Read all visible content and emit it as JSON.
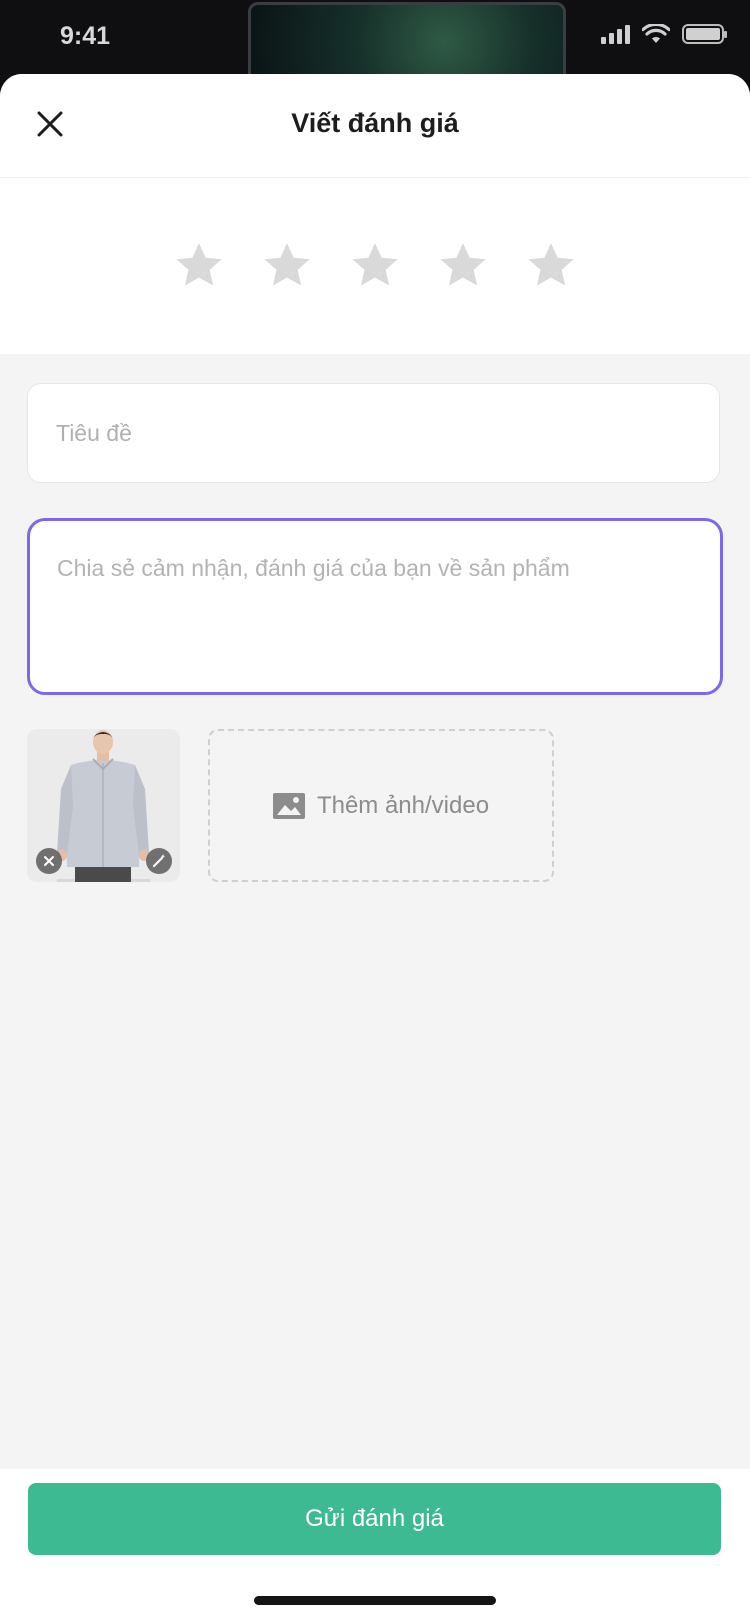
{
  "status_bar": {
    "time": "9:41",
    "icons": [
      "signal-icon",
      "wifi-icon",
      "battery-icon"
    ]
  },
  "header": {
    "title": "Viết đánh giá",
    "close_icon": "close-icon"
  },
  "rating": {
    "max_stars": 5,
    "selected": 0,
    "star_color": "#d9d9d9"
  },
  "form": {
    "title_placeholder": "Tiêu đề",
    "title_value": "",
    "review_placeholder": "Chia sẻ cảm nhận, đánh giá của bạn về sản phẩm",
    "review_value": "",
    "focus_color": "#7b68ee"
  },
  "media": {
    "attached_count": 1,
    "thumbnail_icons": [
      "remove-icon",
      "magic-wand-icon"
    ],
    "add_label": "Thêm ảnh/video",
    "add_icon": "image-icon"
  },
  "footer": {
    "submit_label": "Gửi đánh giá",
    "submit_color": "#3dba91"
  }
}
